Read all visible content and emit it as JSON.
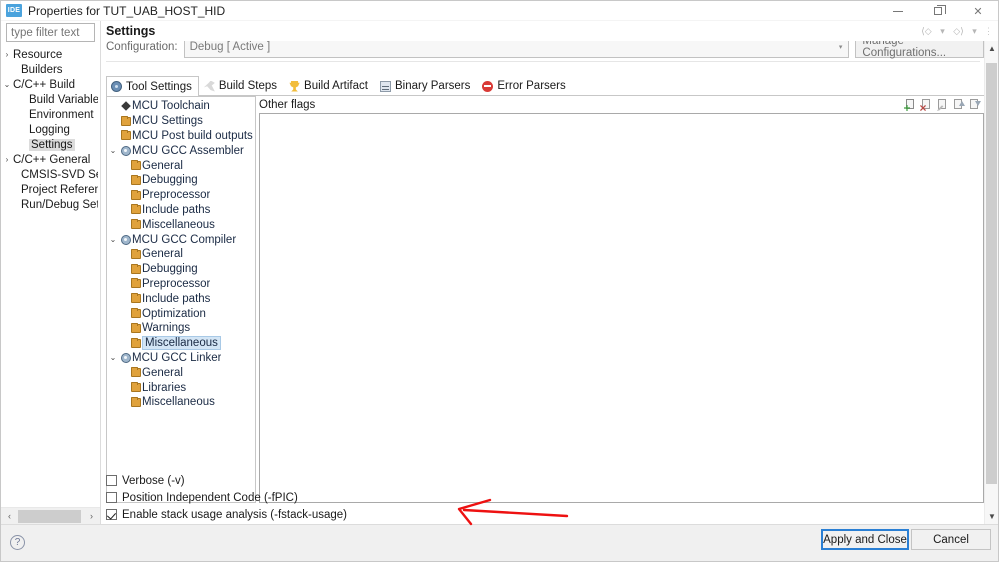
{
  "window": {
    "title": "Properties for TUT_UAB_HOST_HID",
    "app_icon_label": "IDE",
    "controls": {
      "minimize": "—",
      "restore": "❐",
      "close": "✕"
    }
  },
  "page": {
    "title": "Settings",
    "header_buttons": [
      "back-arrow",
      "back-dropdown",
      "forward-arrow",
      "forward-dropdown",
      "view-menu"
    ]
  },
  "sidebar": {
    "filter_placeholder": "type filter text",
    "items": [
      {
        "label": "Resource",
        "twisty": "›",
        "indent": 0,
        "selected": false
      },
      {
        "label": "Builders",
        "twisty": "",
        "indent": 1,
        "selected": false
      },
      {
        "label": "C/C++ Build",
        "twisty": "⌄",
        "indent": 0,
        "selected": false
      },
      {
        "label": "Build Variables",
        "twisty": "",
        "indent": 2,
        "selected": false
      },
      {
        "label": "Environment",
        "twisty": "",
        "indent": 2,
        "selected": false
      },
      {
        "label": "Logging",
        "twisty": "",
        "indent": 2,
        "selected": false
      },
      {
        "label": "Settings",
        "twisty": "",
        "indent": 2,
        "selected": true
      },
      {
        "label": "C/C++ General",
        "twisty": "›",
        "indent": 0,
        "selected": false
      },
      {
        "label": "CMSIS-SVD Settin",
        "twisty": "",
        "indent": 1,
        "selected": false
      },
      {
        "label": "Project Reference:",
        "twisty": "",
        "indent": 1,
        "selected": false
      },
      {
        "label": "Run/Debug Settin",
        "twisty": "",
        "indent": 1,
        "selected": false
      }
    ],
    "hscroll": {
      "left_arrow": "‹",
      "right_arrow": "›"
    }
  },
  "configuration": {
    "label": "Configuration:",
    "value": "Debug  [ Active ]",
    "caret": "▾",
    "manage_button": "Manage Configurations..."
  },
  "tabs": [
    {
      "label": "Tool Settings",
      "icon": "tool-settings-icon",
      "active": true
    },
    {
      "label": "Build Steps",
      "icon": "wrench-icon",
      "active": false
    },
    {
      "label": "Build Artifact",
      "icon": "trophy-icon",
      "active": false
    },
    {
      "label": "Binary Parsers",
      "icon": "binary-icon",
      "active": false
    },
    {
      "label": "Error Parsers",
      "icon": "error-icon",
      "active": false
    }
  ],
  "tool_tree": [
    {
      "label": "MCU Toolchain",
      "twisty": "",
      "indent": 1,
      "icon": "diamond-icon",
      "selected": false
    },
    {
      "label": "MCU Settings",
      "twisty": "",
      "indent": 1,
      "icon": "folder-icon",
      "selected": false
    },
    {
      "label": "MCU Post build outputs",
      "twisty": "",
      "indent": 1,
      "icon": "folder-icon",
      "selected": false
    },
    {
      "label": "MCU GCC Assembler",
      "twisty": "⌄",
      "indent": 0,
      "icon": "gear-icon",
      "selected": false
    },
    {
      "label": "General",
      "twisty": "",
      "indent": 2,
      "icon": "folder-icon",
      "selected": false
    },
    {
      "label": "Debugging",
      "twisty": "",
      "indent": 2,
      "icon": "folder-icon",
      "selected": false
    },
    {
      "label": "Preprocessor",
      "twisty": "",
      "indent": 2,
      "icon": "folder-icon",
      "selected": false
    },
    {
      "label": "Include paths",
      "twisty": "",
      "indent": 2,
      "icon": "folder-icon",
      "selected": false
    },
    {
      "label": "Miscellaneous",
      "twisty": "",
      "indent": 2,
      "icon": "folder-icon",
      "selected": false
    },
    {
      "label": "MCU GCC Compiler",
      "twisty": "⌄",
      "indent": 0,
      "icon": "gear-icon",
      "selected": false
    },
    {
      "label": "General",
      "twisty": "",
      "indent": 2,
      "icon": "folder-icon",
      "selected": false
    },
    {
      "label": "Debugging",
      "twisty": "",
      "indent": 2,
      "icon": "folder-icon",
      "selected": false
    },
    {
      "label": "Preprocessor",
      "twisty": "",
      "indent": 2,
      "icon": "folder-icon",
      "selected": false
    },
    {
      "label": "Include paths",
      "twisty": "",
      "indent": 2,
      "icon": "folder-icon",
      "selected": false
    },
    {
      "label": "Optimization",
      "twisty": "",
      "indent": 2,
      "icon": "folder-icon",
      "selected": false
    },
    {
      "label": "Warnings",
      "twisty": "",
      "indent": 2,
      "icon": "folder-icon",
      "selected": false
    },
    {
      "label": "Miscellaneous",
      "twisty": "",
      "indent": 2,
      "icon": "folder-icon",
      "selected": true
    },
    {
      "label": "MCU GCC Linker",
      "twisty": "⌄",
      "indent": 0,
      "icon": "gear-icon",
      "selected": false
    },
    {
      "label": "General",
      "twisty": "",
      "indent": 2,
      "icon": "folder-icon",
      "selected": false
    },
    {
      "label": "Libraries",
      "twisty": "",
      "indent": 2,
      "icon": "folder-icon",
      "selected": false
    },
    {
      "label": "Miscellaneous",
      "twisty": "",
      "indent": 2,
      "icon": "folder-icon",
      "selected": false
    }
  ],
  "flags": {
    "title": "Other flags",
    "value": "",
    "toolbar": [
      "add-icon",
      "delete-icon",
      "edit-icon",
      "move-up-icon",
      "move-down-icon"
    ]
  },
  "options": [
    {
      "label": "Verbose (-v)",
      "checked": false
    },
    {
      "label": "Position Independent Code (-fPIC)",
      "checked": false
    },
    {
      "label": "Enable stack usage analysis (-fstack-usage)",
      "checked": true
    }
  ],
  "footer": {
    "help": "?",
    "apply_label": "Apply and Close",
    "cancel_label": "Cancel"
  },
  "annotation": {
    "color": "#ee1111",
    "shape": "left-pointing-arrow"
  }
}
